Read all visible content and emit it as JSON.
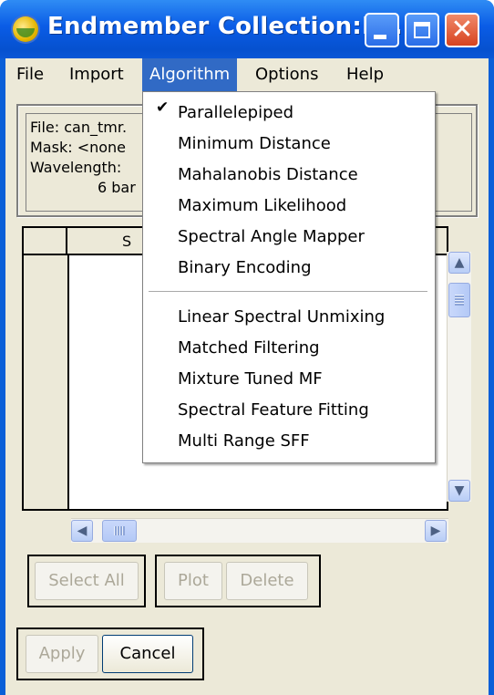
{
  "window": {
    "title": "Endmember Collection:P...",
    "controls": {
      "minimize": "minimize",
      "maximize": "maximize",
      "close": "✕"
    }
  },
  "menubar": {
    "items": [
      "File",
      "Import",
      "Algorithm",
      "Options",
      "Help"
    ],
    "active": "Algorithm"
  },
  "info": {
    "file": "File: can_tmr.",
    "mask": "Mask: <none",
    "wavelength": "Wavelength:",
    "bands": "6 bar"
  },
  "table": {
    "column_header": "S"
  },
  "buttons": {
    "select_all": "Select All",
    "plot": "Plot",
    "delete": "Delete",
    "apply": "Apply",
    "cancel": "Cancel"
  },
  "algorithm_menu": {
    "group1": [
      "Parallelepiped",
      "Minimum Distance",
      "Mahalanobis Distance",
      "Maximum Likelihood",
      "Spectral Angle Mapper",
      "Binary Encoding"
    ],
    "group2": [
      "Linear Spectral Unmixing",
      "Matched Filtering",
      "Mixture Tuned MF",
      "Spectral Feature Fitting",
      "Multi Range SFF"
    ],
    "checked": "Parallelepiped",
    "check_glyph": "✔"
  },
  "colors": {
    "titlebar": "#0a5ce6",
    "menu_highlight": "#316ac5",
    "window_bg": "#ece9d8",
    "disabled_text": "#aca899"
  },
  "icons": [
    "app-icon",
    "minimize-icon",
    "maximize-icon",
    "close-icon",
    "check-icon",
    "scroll-up-icon",
    "scroll-down-icon",
    "scroll-left-icon",
    "scroll-right-icon"
  ]
}
